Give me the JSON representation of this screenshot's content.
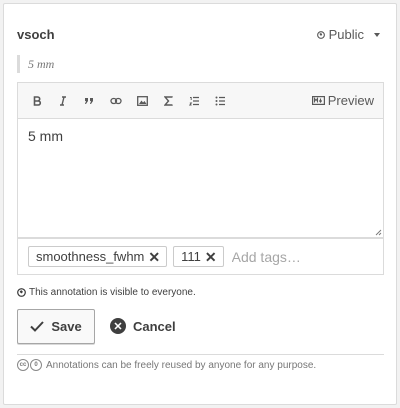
{
  "annotation": {
    "username": "vsoch",
    "privacy_label": "Public",
    "quote": "5 mm",
    "body_text": "5 mm"
  },
  "toolbar": {
    "buttons": [
      "bold-icon",
      "italic-icon",
      "quote-icon",
      "link-icon",
      "image-icon",
      "math-icon",
      "numbered-list-icon",
      "bulleted-list-icon"
    ],
    "preview_label": "Preview"
  },
  "tags": {
    "items": [
      {
        "label": "smoothness_fwhm",
        "remove": "✕"
      },
      {
        "label": "111",
        "remove": "✕"
      }
    ],
    "placeholder": "Add tags…"
  },
  "visibility_note": "This annotation is visible to everyone.",
  "actions": {
    "save_label": "Save",
    "cancel_label": "Cancel"
  },
  "license_note": "Annotations can be freely reused by anyone for any purpose."
}
